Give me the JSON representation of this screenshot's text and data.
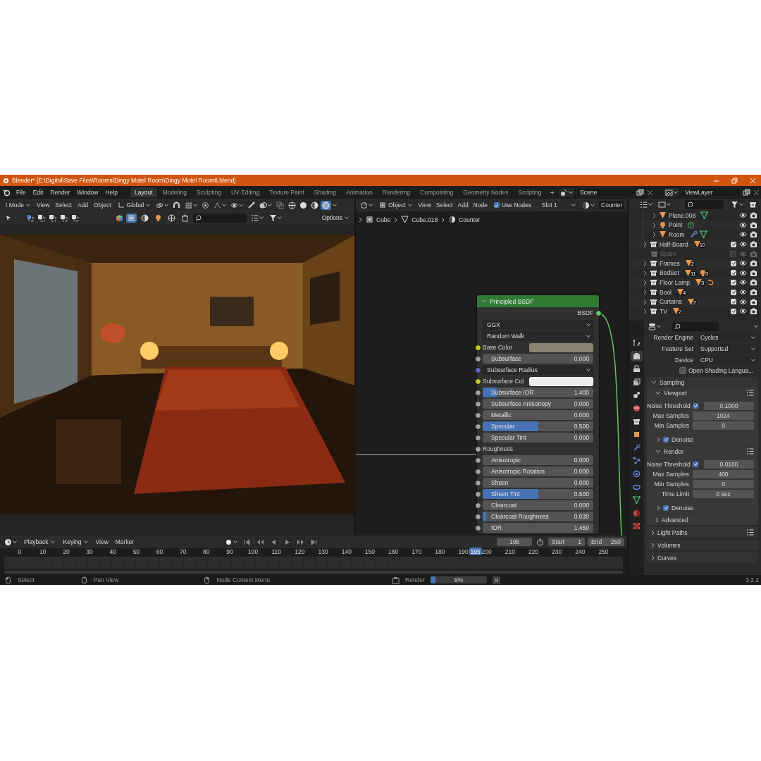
{
  "window": {
    "title": "Blender* [E:\\Digital\\Save Files\\Rooms\\Dingy Motel Room\\Dingy Motel Room6.blend]"
  },
  "menus": [
    "File",
    "Edit",
    "Render",
    "Window",
    "Help"
  ],
  "workspaces": [
    {
      "label": "Layout",
      "selected": true
    },
    {
      "label": "Modeling",
      "selected": false
    },
    {
      "label": "Sculpting",
      "selected": false
    },
    {
      "label": "UV Editing",
      "selected": false
    },
    {
      "label": "Texture Paint",
      "selected": false
    },
    {
      "label": "Shading",
      "selected": false
    },
    {
      "label": "Animation",
      "selected": false
    },
    {
      "label": "Rendering",
      "selected": false
    },
    {
      "label": "Compositing",
      "selected": false
    },
    {
      "label": "Geometry Nodes",
      "selected": false
    },
    {
      "label": "Scripting",
      "selected": false
    }
  ],
  "add_workspace": "+",
  "scene": "Scene",
  "view_layer": "ViewLayer",
  "viewport": {
    "mode": "t Mode",
    "menus": [
      "View",
      "Select",
      "Add",
      "Object"
    ],
    "orientation": "Global",
    "shading": [
      {
        "kind": "wireframe",
        "selected": false
      },
      {
        "kind": "solid",
        "selected": false
      },
      {
        "kind": "material",
        "selected": false
      },
      {
        "kind": "rendered",
        "selected": true
      }
    ],
    "options": "Options"
  },
  "node_editor": {
    "object": "Object",
    "menus": [
      "View",
      "Select",
      "Add",
      "Node"
    ],
    "use_nodes": {
      "label": "Use Nodes",
      "checked": true
    },
    "slot": "Slot 1",
    "material": "Counter",
    "breadcrumbs": [
      "Cube",
      "Cube.018",
      "Counter"
    ],
    "node": {
      "title": "Principled BSDF",
      "output": "BSDF",
      "dropdowns": [
        "GGX",
        "Random Walk"
      ],
      "inputs": [
        {
          "kind": "color",
          "label": "Base Color",
          "socket": {
            "color": "#c7c729"
          },
          "color": "#8b8470"
        },
        {
          "kind": "value",
          "label": "Subsurface",
          "value": "0.000",
          "level": 0,
          "socket": {
            "color": "#a1a1a1"
          }
        },
        {
          "kind": "dropdown",
          "label": "Subsurface Radius",
          "socket": {
            "color": "#6363c7"
          }
        },
        {
          "kind": "color",
          "label": "Subsurface Col",
          "socket": {
            "color": "#c7c729"
          },
          "color": "#ececec"
        },
        {
          "kind": "value",
          "label": "Subsurface IOR",
          "value": "1.400",
          "level": 0.13,
          "socket": {
            "color": "#a1a1a1"
          }
        },
        {
          "kind": "value",
          "label": "Subsurface Anisotropy",
          "value": "0.000",
          "level": 0,
          "socket": {
            "color": "#a1a1a1"
          }
        },
        {
          "kind": "value",
          "label": "Metallic",
          "value": "0.000",
          "level": 0,
          "socket": {
            "color": "#a1a1a1"
          }
        },
        {
          "kind": "value",
          "label": "Specular",
          "value": "0.500",
          "level": 0.5,
          "socket": {
            "color": "#a1a1a1"
          }
        },
        {
          "kind": "value",
          "label": "Specular Tint",
          "value": "0.000",
          "level": 0,
          "socket": {
            "color": "#a1a1a1"
          }
        },
        {
          "kind": "linked",
          "label": "Roughness",
          "socket": {
            "color": "#a1a1a1"
          }
        },
        {
          "kind": "value",
          "label": "Anisotropic",
          "value": "0.000",
          "level": 0,
          "socket": {
            "color": "#a1a1a1"
          }
        },
        {
          "kind": "value",
          "label": "Anisotropic Rotation",
          "value": "0.000",
          "level": 0,
          "socket": {
            "color": "#a1a1a1"
          }
        },
        {
          "kind": "value",
          "label": "Sheen",
          "value": "0.000",
          "level": 0,
          "socket": {
            "color": "#a1a1a1"
          }
        },
        {
          "kind": "value",
          "label": "Sheen Tint",
          "value": "0.500",
          "level": 0.5,
          "socket": {
            "color": "#a1a1a1"
          }
        },
        {
          "kind": "value",
          "label": "Clearcoat",
          "value": "0.000",
          "level": 0,
          "socket": {
            "color": "#a1a1a1"
          }
        },
        {
          "kind": "value",
          "label": "Clearcoat Roughness",
          "value": "0.030",
          "level": 0.03,
          "socket": {
            "color": "#a1a1a1"
          }
        },
        {
          "kind": "value",
          "label": "IOR",
          "value": "1.450",
          "level": 0,
          "socket": {
            "color": "#a1a1a1"
          }
        }
      ]
    }
  },
  "outliner": {
    "nested_objects": [
      {
        "name": "Plane.008",
        "kind": "mesh"
      },
      {
        "name": "Point",
        "kind": "light"
      },
      {
        "name": "Room",
        "kind": "mesh_modified"
      }
    ],
    "collections": [
      {
        "name": "Half-Board",
        "checked": true,
        "badges": [
          {
            "kind": "mesh",
            "count": "10"
          }
        ]
      },
      {
        "name": "Spare",
        "checked": false
      },
      {
        "name": "Frames",
        "checked": true,
        "badges": [
          {
            "kind": "mesh",
            "count": "2"
          }
        ]
      },
      {
        "name": "BedSet",
        "checked": true,
        "badges": [
          {
            "kind": "mesh",
            "count": "11"
          },
          {
            "kind": "light",
            "count": "3"
          }
        ]
      },
      {
        "name": "Floor Lamp",
        "checked": true,
        "badges": [
          {
            "kind": "mesh",
            "count": "3"
          },
          {
            "kind": "curve"
          }
        ]
      },
      {
        "name": "Bool",
        "checked": true,
        "badges": [
          {
            "kind": "mesh",
            "count": "4"
          }
        ]
      },
      {
        "name": "Curtains",
        "checked": true,
        "badges": [
          {
            "kind": "mesh",
            "count": "2"
          }
        ]
      },
      {
        "name": "TV",
        "checked": true,
        "badges": [
          {
            "kind": "mesh",
            "count": "2"
          }
        ]
      }
    ]
  },
  "properties": {
    "tabs": [
      {
        "kind": "tool",
        "selected": false
      },
      {
        "kind": "render",
        "selected": true
      },
      {
        "kind": "output",
        "selected": false
      },
      {
        "kind": "view_layer",
        "selected": false
      },
      {
        "kind": "scene",
        "selected": false
      },
      {
        "kind": "world",
        "selected": false
      },
      {
        "kind": "collection",
        "selected": false
      },
      {
        "kind": "object",
        "selected": false
      },
      {
        "kind": "modifier",
        "selected": false
      },
      {
        "kind": "particles",
        "selected": false
      },
      {
        "kind": "physics",
        "selected": false
      },
      {
        "kind": "constraints",
        "selected": false
      },
      {
        "kind": "data",
        "selected": false
      },
      {
        "kind": "material",
        "selected": false
      },
      {
        "kind": "texture",
        "selected": false
      }
    ],
    "settings": [
      {
        "label": "Render Engine",
        "value": "Cycles"
      },
      {
        "label": "Feature Set",
        "value": "Supported"
      },
      {
        "label": "Device",
        "value": "CPU"
      }
    ],
    "osl": {
      "label": "Open Shading Langua...",
      "checked": false
    },
    "panels": [
      {
        "title": "Sampling",
        "expanded": true,
        "presets": false,
        "subpanels": [
          {
            "title": "Viewport",
            "expanded": true,
            "presets": true,
            "rows": [
              {
                "label": "Noise Threshold",
                "value": "0.1000",
                "checked": true
              },
              {
                "label": "Max Samples",
                "value": "1024"
              },
              {
                "label": "Min Samples",
                "value": "0"
              }
            ],
            "children": [
              {
                "title": "Denoise",
                "expanded": false,
                "checked": true
              }
            ]
          },
          {
            "title": "Render",
            "expanded": true,
            "presets": true,
            "rows": [
              {
                "label": "Noise Threshold",
                "value": "0.0100",
                "checked": true
              },
              {
                "label": "Max Samples",
                "value": "400"
              },
              {
                "label": "Min Samples",
                "value": "0"
              },
              {
                "label": "Time Limit",
                "value": "0 sec"
              }
            ],
            "children": [
              {
                "title": "Denoise",
                "expanded": false,
                "checked": true
              }
            ]
          },
          {
            "title": "Advanced",
            "expanded": false,
            "presets": false
          }
        ]
      },
      {
        "title": "Light Paths",
        "expanded": false,
        "presets": true
      },
      {
        "title": "Volumes",
        "expanded": false,
        "presets": false
      },
      {
        "title": "Curves",
        "expanded": false,
        "presets": false
      }
    ]
  },
  "timeline": {
    "menus": [
      {
        "label": "Playback",
        "dropdown": true
      },
      {
        "label": "Keying",
        "dropdown": true
      },
      {
        "label": "View",
        "dropdown": false
      },
      {
        "label": "Marker",
        "dropdown": false
      }
    ],
    "frame": "195",
    "start_label": "Start",
    "start": "1",
    "end_label": "End",
    "end": "250",
    "ruler": [
      "0",
      "10",
      "20",
      "30",
      "40",
      "50",
      "60",
      "70",
      "80",
      "90",
      "100",
      "110",
      "120",
      "130",
      "140",
      "150",
      "160",
      "170",
      "180",
      "190",
      "200",
      "210",
      "220",
      "230",
      "240",
      "250"
    ],
    "playhead": {
      "label": "195",
      "level": 0.78
    }
  },
  "status_bar": {
    "hints": [
      {
        "kind": "left_mouse",
        "label": "Select"
      },
      {
        "kind": "middle_mouse",
        "label": "Pan View"
      },
      {
        "kind": "right_mouse",
        "label": "Node Context Menu"
      }
    ],
    "job": {
      "label": "Render",
      "level": 0.09,
      "reading": "9%"
    },
    "version": "3.2.2"
  }
}
